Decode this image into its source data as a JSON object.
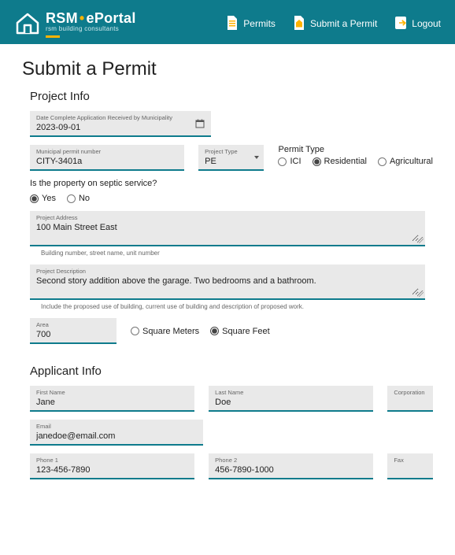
{
  "nav": {
    "brand_main_a": "RSM",
    "brand_main_b": "ePortal",
    "brand_sub": "rsm building consultants",
    "links": {
      "permits": "Permits",
      "submit": "Submit a Permit",
      "logout": "Logout"
    }
  },
  "page_title": "Submit a Permit",
  "sections": {
    "project": "Project Info",
    "applicant": "Applicant Info"
  },
  "project": {
    "date_label": "Date Complete Application Received by Municipality",
    "date_value": "2023-09-01",
    "muni_label": "Municipal permit number",
    "muni_value": "CITY-3401a",
    "ptype_label": "Project Type",
    "ptype_value": "PE",
    "permit_type_label": "Permit Type",
    "permit_type_options": {
      "ici": "ICI",
      "residential": "Residential",
      "agricultural": "Agricultural"
    },
    "permit_type_selected": "residential",
    "septic_question": "Is the property on septic service?",
    "septic_options": {
      "yes": "Yes",
      "no": "No"
    },
    "septic_selected": "yes",
    "address_label": "Project Address",
    "address_value": "100 Main Street East",
    "address_helper": "Building number, street name, unit number",
    "desc_label": "Project Description",
    "desc_value": "Second story addition above the garage. Two bedrooms and a bathroom.",
    "desc_helper": "Include the proposed use of building, current use of building and description of proposed work.",
    "area_label": "Area",
    "area_value": "700",
    "area_units": {
      "sqm": "Square Meters",
      "sqft": "Square Feet"
    },
    "area_unit_selected": "sqft"
  },
  "applicant": {
    "first_label": "First Name",
    "first_value": "Jane",
    "last_label": "Last Name",
    "last_value": "Doe",
    "corp_label": "Corporation",
    "email_label": "Email",
    "email_value": "janedoe@email.com",
    "phone1_label": "Phone 1",
    "phone1_value": "123-456-7890",
    "phone2_label": "Phone 2",
    "phone2_value": "456-7890-1000",
    "fax_label": "Fax"
  }
}
